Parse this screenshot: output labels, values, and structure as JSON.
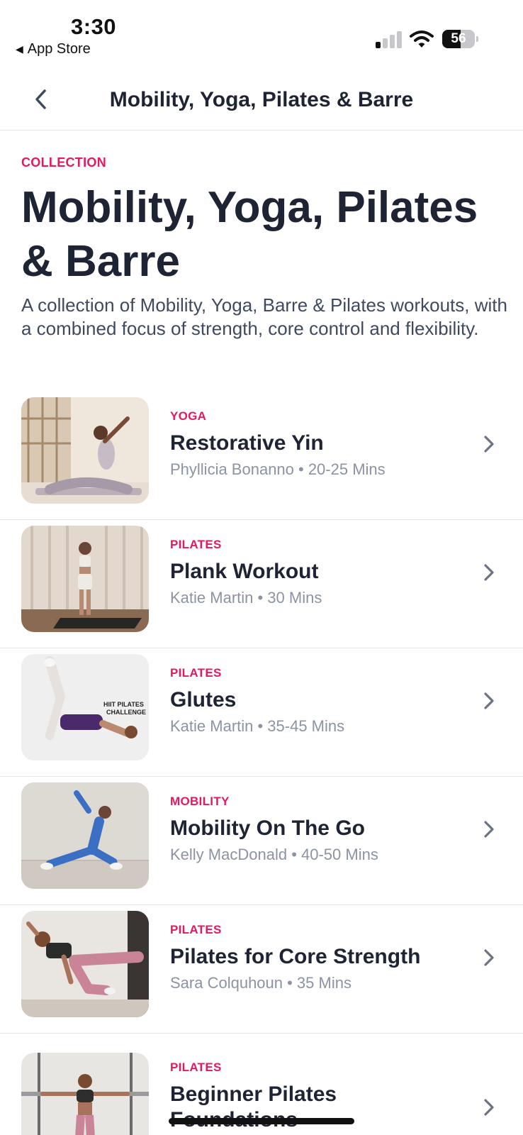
{
  "status_bar": {
    "time": "3:30",
    "back_app": "App Store",
    "battery_level": "56",
    "battery_fraction": 0.56,
    "signal_bars_active": 1,
    "signal_bars_total": 4
  },
  "nav": {
    "title": "Mobility, Yoga, Pilates & Barre",
    "back_icon": "chevron-left-icon"
  },
  "intro": {
    "label": "COLLECTION",
    "title": "Mobility, Yoga, Pilates & Barre",
    "description": "A collection of Mobility, Yoga, Barre & Pilates workouts, with a combined focus of strength, core control and flexibility."
  },
  "workouts": [
    {
      "category": "YOGA",
      "name": "Restorative Yin",
      "meta": "Phyllicia Bonanno • 20-25 Mins"
    },
    {
      "category": "PILATES",
      "name": "Plank Workout",
      "meta": "Katie Martin • 30 Mins"
    },
    {
      "category": "PILATES",
      "name": "Glutes",
      "meta": "Katie Martin • 35-45 Mins",
      "thumb_text": "HIIT PILATES CHALLENGE"
    },
    {
      "category": "MOBILITY",
      "name": "Mobility On The Go",
      "meta": "Kelly MacDonald • 40-50 Mins"
    },
    {
      "category": "PILATES",
      "name": "Pilates for Core Strength",
      "meta": "Sara Colquhoun • 35 Mins"
    },
    {
      "category": "PILATES",
      "name": "Beginner Pilates Foundations",
      "meta": ""
    }
  ],
  "colors": {
    "accent": "#e5195e",
    "text_primary": "#1e2433",
    "text_secondary": "#8b93a4",
    "divider": "#e3e4e8"
  }
}
